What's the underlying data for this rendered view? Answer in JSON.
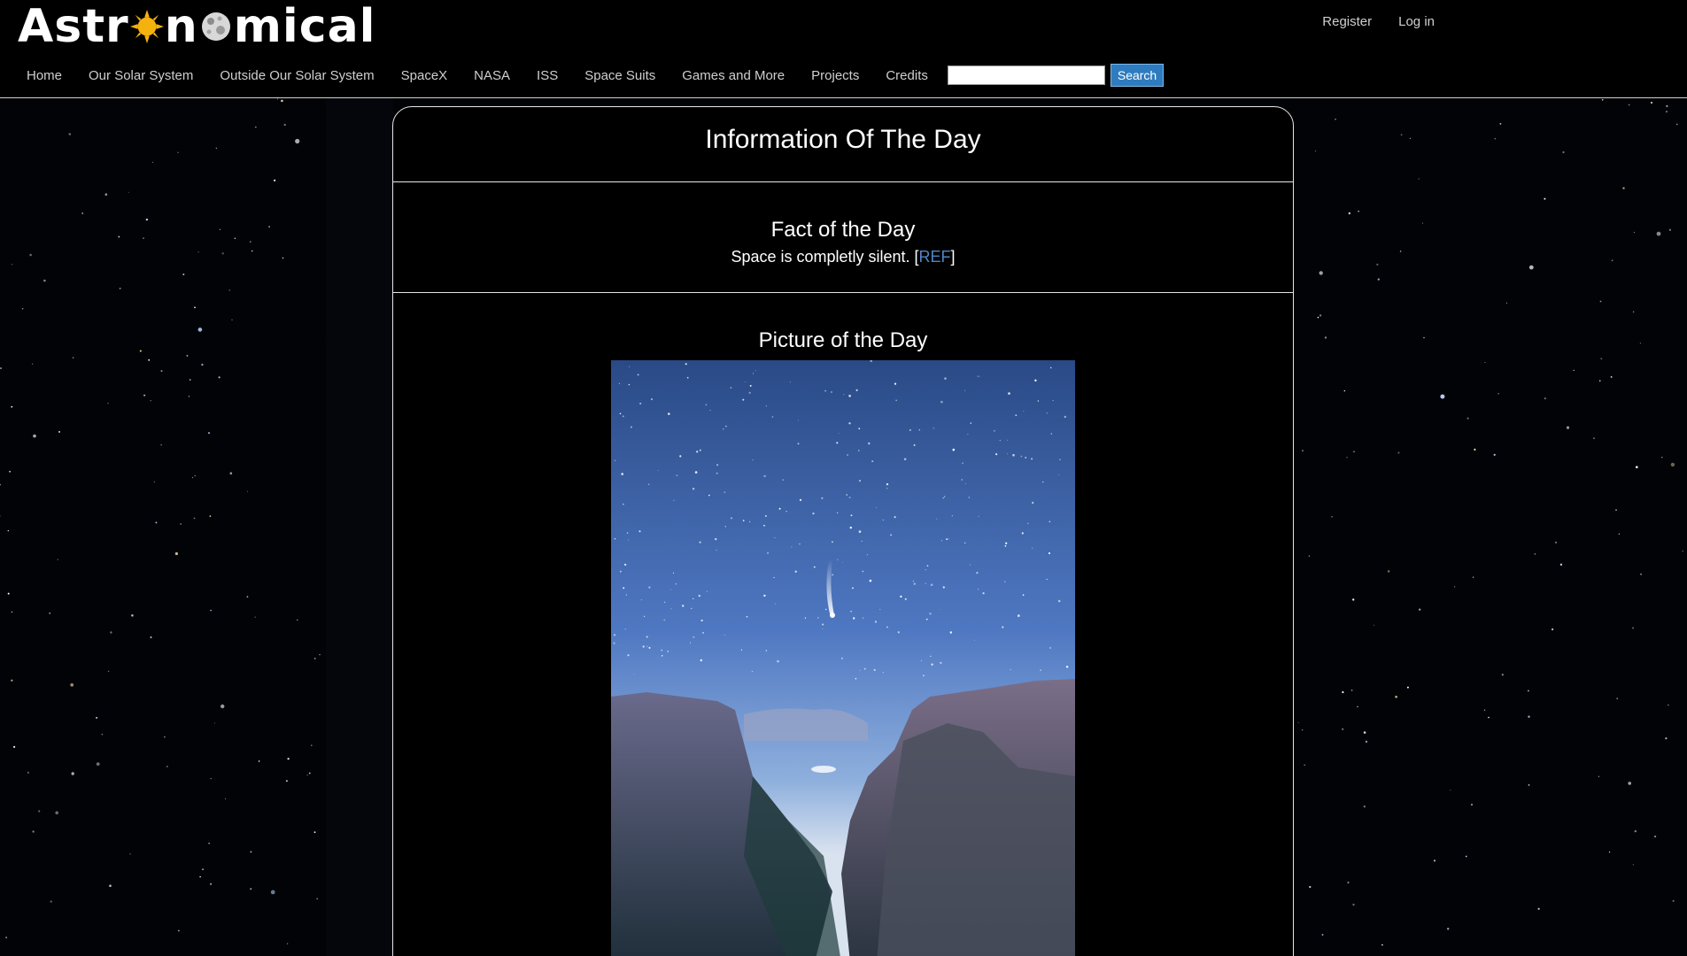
{
  "site": {
    "logo_text_start": "Astr",
    "logo_text_end": "mical",
    "logo_text_mid": "n"
  },
  "top_links": {
    "register": "Register",
    "login": "Log in"
  },
  "nav": {
    "items": [
      "Home",
      "Our Solar System",
      "Outside Our Solar System",
      "SpaceX",
      "NASA",
      "ISS",
      "Space Suits",
      "Games and More",
      "Projects",
      "Credits"
    ],
    "search_value": "",
    "search_button": "Search"
  },
  "main": {
    "title": "Information Of The Day",
    "fact": {
      "heading": "Fact of the Day",
      "text": "Space is completly silent. [",
      "ref_label": "REF",
      "close_bracket": "]"
    },
    "picture": {
      "heading": "Picture of the Day",
      "image_alt": "comet over canyon"
    }
  },
  "colors": {
    "accent_link": "#4f86c6",
    "search_button": "#2e7cbf",
    "background": "#000000"
  }
}
